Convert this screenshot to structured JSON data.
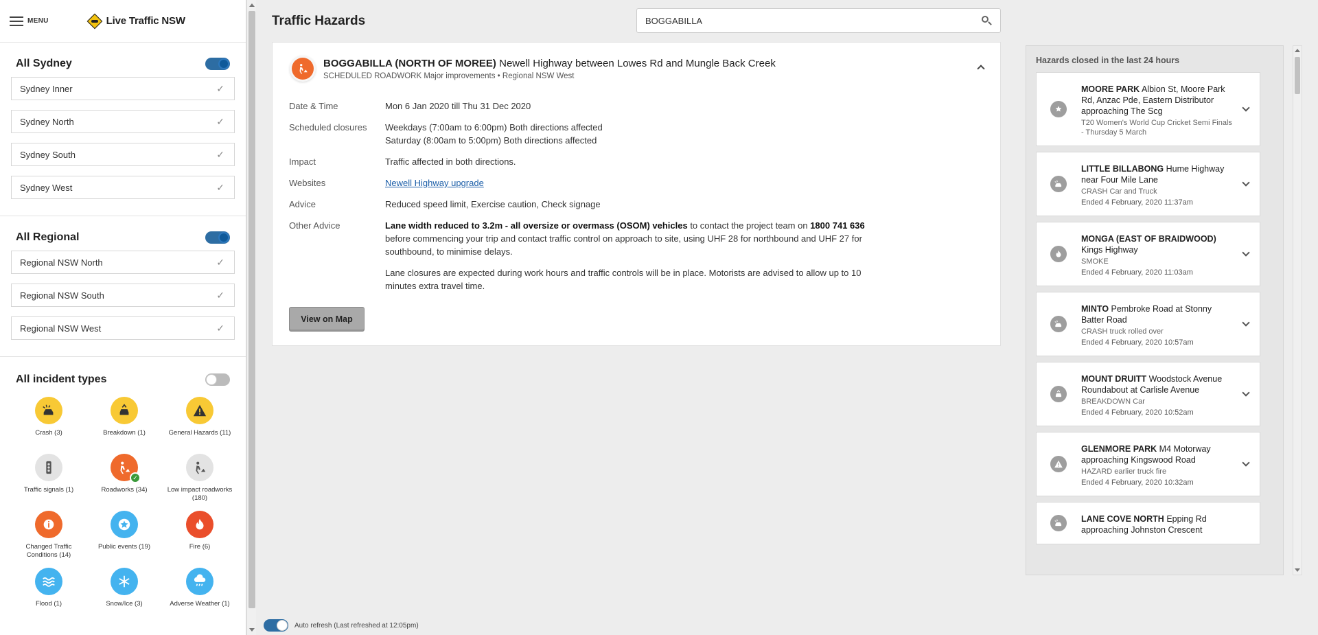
{
  "app": {
    "menu_label": "MENU",
    "brand": "Live Traffic NSW"
  },
  "sidebar": {
    "sydney": {
      "title": "All Sydney",
      "toggle_on": true,
      "regions": [
        "Sydney Inner",
        "Sydney North",
        "Sydney South",
        "Sydney West"
      ]
    },
    "regional": {
      "title": "All Regional",
      "toggle_on": true,
      "regions": [
        "Regional NSW North",
        "Regional NSW South",
        "Regional NSW West"
      ]
    },
    "types": {
      "title": "All incident types",
      "toggle_on": false,
      "items": [
        {
          "label": "Crash  (3)",
          "icon": "crash-icon",
          "color": "#f8c935"
        },
        {
          "label": "Breakdown (1)",
          "icon": "breakdown-icon",
          "color": "#f8c935"
        },
        {
          "label": "General Hazards  (11)",
          "icon": "warning-icon",
          "color": "#f8c935"
        },
        {
          "label": "Traffic signals  (1)",
          "icon": "traffic-light-icon",
          "color": "#e3e3e3"
        },
        {
          "label": "Roadworks  (34)",
          "icon": "roadworks-icon",
          "color": "#ef6a2c",
          "selected": true
        },
        {
          "label": "Low impact roadworks  (180)",
          "icon": "low-impact-roadworks-icon",
          "color": "#e3e3e3"
        },
        {
          "label": "Changed Traffic Conditions  (14)",
          "icon": "info-icon",
          "color": "#ef6a2c"
        },
        {
          "label": "Public events  (19)",
          "icon": "star-icon",
          "color": "#44b3ef"
        },
        {
          "label": "Fire  (6)",
          "icon": "fire-icon",
          "color": "#ea4e2b"
        },
        {
          "label": "Flood  (1)",
          "icon": "flood-icon",
          "color": "#44b3ef"
        },
        {
          "label": "Snow/Ice  (3)",
          "icon": "snowflake-icon",
          "color": "#44b3ef"
        },
        {
          "label": "Adverse Weather  (1)",
          "icon": "weather-icon",
          "color": "#44b3ef"
        }
      ]
    }
  },
  "main": {
    "title": "Traffic Hazards",
    "search": {
      "value": "BOGGABILLA",
      "placeholder": ""
    },
    "hazard": {
      "location": "BOGGABILLA (NORTH OF MOREE)",
      "road": " Newell Highway between Lowes Rd and Mungle Back Creek",
      "subtitle": "SCHEDULED ROADWORK Major improvements • Regional NSW West",
      "details": {
        "date_label": "Date & Time",
        "date_value": "Mon 6 Jan 2020 till Thu 31 Dec 2020",
        "closures_label": "Scheduled closures",
        "closures_line1": "Weekdays (7:00am to 6:00pm) Both directions affected",
        "closures_line2": "Saturday (8:00am to 5:00pm) Both directions affected",
        "impact_label": "Impact",
        "impact_value": "Traffic affected in both directions.",
        "websites_label": "Websites",
        "websites_link": "Newell Highway upgrade",
        "advice_label": "Advice",
        "advice_value": "Reduced speed limit, Exercise caution, Check signage",
        "other_label": "Other Advice",
        "other_bold1": "Lane width reduced to 3.2m  - all oversize or overmass (OSOM) vehicles",
        "other_text1": " to contact the project team on ",
        "other_phone": "1800  741  636",
        "other_text2": " before commencing your trip and contact traffic control on approach to site, using UHF 28 for northbound and  UHF 27 for southbound, to minimise delays.",
        "other_para2": "Lane closures are expected during work hours and traffic controls will be in place.   Motorists are advised to allow up to 10 minutes extra travel time."
      },
      "map_button": "View on Map"
    },
    "auto_refresh": "Auto refresh (Last refreshed at 12:05pm)"
  },
  "closed": {
    "title": "Hazards closed in the last 24 hours",
    "items": [
      {
        "location": "MOORE PARK",
        "road": " Albion St, Moore Park Rd, Anzac Pde, Eastern Distributor approaching The Scg",
        "category": "T20 Women's World Cup Cricket Semi Finals - Thursday 5 March",
        "time": "",
        "icon": "star-icon"
      },
      {
        "location": "LITTLE BILLABONG",
        "road": " Hume Highway near Four Mile Lane",
        "category": "CRASH Car and Truck",
        "time": "Ended 4 February, 2020 11:37am",
        "icon": "crash-icon"
      },
      {
        "location": "MONGA (EAST OF BRAIDWOOD)",
        "road": " Kings Highway",
        "category": "SMOKE",
        "time": "Ended 4 February, 2020 11:03am",
        "icon": "fire-icon"
      },
      {
        "location": "MINTO",
        "road": " Pembroke Road at Stonny Batter Road",
        "category": "CRASH truck rolled over",
        "time": "Ended 4 February, 2020 10:57am",
        "icon": "crash-icon"
      },
      {
        "location": "MOUNT DRUITT",
        "road": " Woodstock Avenue Roundabout at Carlisle Avenue",
        "category": "BREAKDOWN Car",
        "time": "Ended 4 February, 2020 10:52am",
        "icon": "breakdown-icon"
      },
      {
        "location": "GLENMORE PARK",
        "road": " M4 Motorway approaching Kingswood Road",
        "category": "HAZARD earlier truck fire",
        "time": "Ended 4 February, 2020 10:32am",
        "icon": "warning-icon"
      },
      {
        "location": "LANE COVE NORTH",
        "road": " Epping Rd approaching Johnston Crescent",
        "category": "",
        "time": "",
        "icon": "crash-icon"
      }
    ]
  }
}
